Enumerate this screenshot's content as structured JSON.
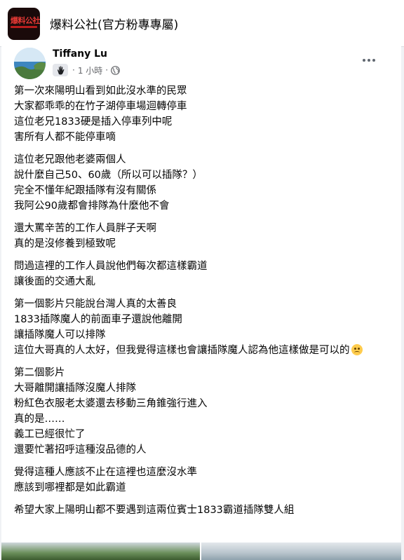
{
  "group": {
    "name": "爆料公社(官方粉專專屬)",
    "logo_text": "爆料公社"
  },
  "post": {
    "author": "Tiffany Lu",
    "time": "1 小時",
    "separator": "·",
    "paragraphs": [
      {
        "lines": [
          "第一次來陽明山看到如此沒水準的民眾",
          "大家都乖乖的在竹子湖停車場迴轉停車",
          "這位老兄1833硬是插入停車列中呢",
          "害所有人都不能停車嘀"
        ]
      },
      {
        "lines": [
          "這位老兄跟他老婆兩個人",
          "說什麼自己50、60歲（所以可以插隊？）",
          "完全不懂年紀跟插隊有沒有關係",
          "我阿公90歲都會排隊為什麼他不會"
        ]
      },
      {
        "lines": [
          "還大罵辛苦的工作人員胖子天啊",
          "真的是沒修養到極致呢"
        ]
      },
      {
        "lines": [
          "問過這裡的工作人員說他們每次都這樣霸道",
          "讓後面的交通大亂"
        ]
      },
      {
        "lines": [
          "第一個影片只能說台灣人真的太善良",
          "1833插隊魔人的前面車子還說他離開",
          "讓插隊魔人可以排隊",
          "這位大哥真的人太好，但我覺得這樣也會讓插隊魔人認為他這樣做是可以的"
        ]
      },
      {
        "lines": [
          "第二個影片",
          "大哥離開讓插隊沒魔人排隊",
          "粉紅色衣服老太婆還去移動三角錐強行進入",
          "真的是……",
          "義工已經很忙了",
          "還要忙著招呼這種沒品德的人"
        ]
      },
      {
        "lines": [
          "覺得這種人應該不止在這裡也這麼沒水準",
          "應該到哪裡都是如此霸道"
        ]
      },
      {
        "lines": [
          "希望大家上陽明山都不要遇到這兩位賓士1833霸道插隊雙人組"
        ]
      }
    ]
  },
  "icons": {
    "avatar": "profile-photo",
    "badge": "hand-wave-icon",
    "audience": "globe-icon",
    "more": "more-options-icon",
    "emoji": "worried-face-emoji"
  },
  "colors": {
    "card": "#ffffff",
    "background": "#f0f2f5",
    "secondary_text": "#65676b"
  }
}
